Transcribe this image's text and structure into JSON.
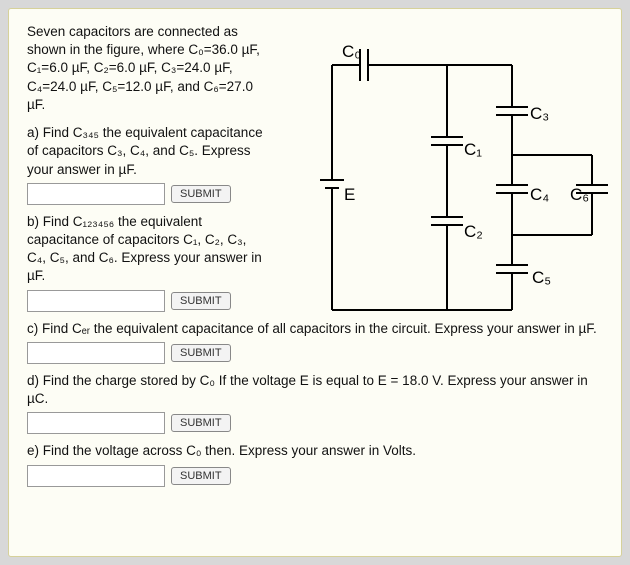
{
  "intro": "Seven capacitors are connected as shown in the figure, where C₀=36.0 µF, C₁=6.0 µF, C₂=6.0 µF, C₃=24.0 µF, C₄=24.0 µF, C₅=12.0 µF, and C₆=27.0 µF.",
  "questions": {
    "a": "a) Find C₃₄₅ the equivalent capacitance of capacitors C₃, C₄, and C₅. Express your answer in µF.",
    "b": "b) Find C₁₂₃₄₅₆ the equivalent capacitance of capacitors C₁, C₂, C₃, C₄, C₅, and C₆. Express your answer in µF.",
    "c": "c) Find Cₑᵣ the equivalent capacitance of all capacitors in the circuit. Express your answer in µF.",
    "d": "d) Find the charge stored by C₀ If the voltage E is equal to E = 18.0 V. Express your answer in µC.",
    "e": "e) Find the voltage across C₀ then. Express your answer in Volts."
  },
  "buttons": {
    "submit": "SUBMIT"
  },
  "circuit": {
    "labels": {
      "E": "E",
      "C0": "C₀",
      "C1": "C₁",
      "C2": "C₂",
      "C3": "C₃",
      "C4": "C₄",
      "C5": "C₅",
      "C6": "C₆"
    }
  }
}
